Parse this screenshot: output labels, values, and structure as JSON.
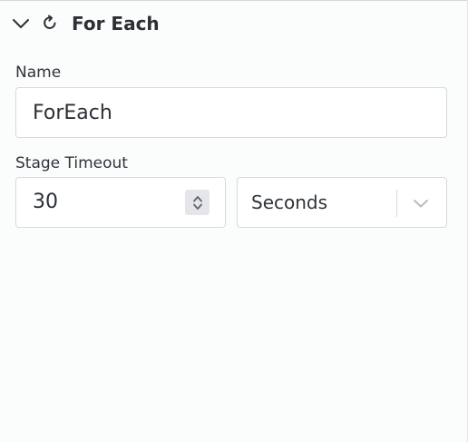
{
  "header": {
    "title": "For Each",
    "toggle_icon": "chevron-down-icon",
    "type_icon": "loop-icon"
  },
  "fields": {
    "name": {
      "label": "Name",
      "value": "ForEach"
    },
    "stage_timeout": {
      "label": "Stage Timeout",
      "value": "30",
      "unit": "Seconds"
    }
  },
  "colors": {
    "background": "#fbfcfc",
    "border": "#d6dadd",
    "text": "#2b3036",
    "stepper_bg": "#e4e6e9",
    "muted_icon": "#b7bcc1"
  }
}
